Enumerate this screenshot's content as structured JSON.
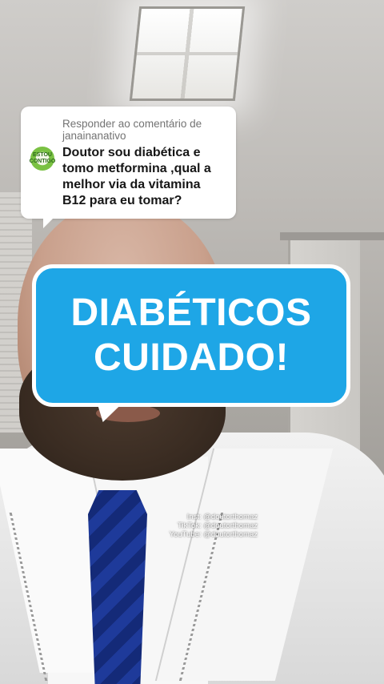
{
  "reply_card": {
    "header": "Responder ao comentário de janainanativo",
    "avatar_text": "ESTOU CONTIGO",
    "comment": "Doutor sou diabética e tomo metformina ,qual a melhor via da vitamina B12 para eu tomar?"
  },
  "caption": {
    "line1": "DIABÉTICOS",
    "line2": "CUIDADO!",
    "color": "#1ea6e6"
  },
  "watermark": {
    "inst": "Inst: @doutorthomaz",
    "tiktok": "TikTok: @doutorthomaz",
    "youtube": "YouTube: @doutorthomaz"
  }
}
